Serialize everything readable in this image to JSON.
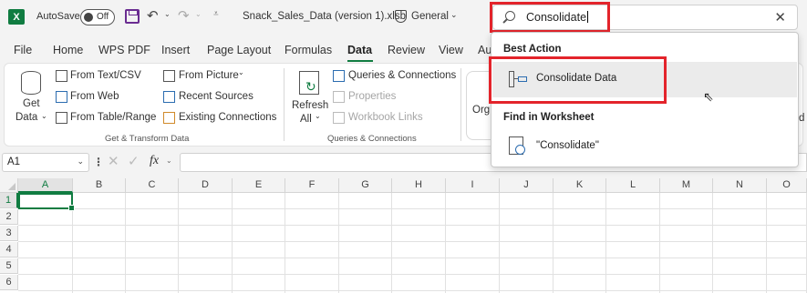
{
  "titlebar": {
    "app_logo": "X",
    "autosave_label": "AutoSave",
    "autosave_state": "Off",
    "document_title": "Snack_Sales_Data (version 1).xlsb",
    "sensitivity_label": "General",
    "icons": [
      "excel-logo-icon",
      "save-icon",
      "undo-icon",
      "redo-icon",
      "customize-qat-icon",
      "shield-icon"
    ]
  },
  "search": {
    "query": "Consolidate",
    "close_glyph": "✕"
  },
  "search_dropdown": {
    "best_action_heading": "Best Action",
    "best_action_item": "Consolidate Data",
    "find_heading": "Find in Worksheet",
    "find_item": "\"Consolidate\""
  },
  "tabs": [
    "File",
    "Home",
    "WPS PDF",
    "Insert",
    "Page Layout",
    "Formulas",
    "Data",
    "Review",
    "View",
    "Au"
  ],
  "active_tab": "Data",
  "ribbon": {
    "get_data_label_1": "Get",
    "get_data_label_2": "Data",
    "from_text_csv": "From Text/CSV",
    "from_web": "From Web",
    "from_table_range": "From Table/Range",
    "from_picture": "From Picture",
    "recent_sources": "Recent Sources",
    "existing_connections": "Existing Connections",
    "group_get_transform": "Get & Transform Data",
    "refresh_label_1": "Refresh",
    "refresh_label_2": "All",
    "queries_connections": "Queries & Connections",
    "properties": "Properties",
    "workbook_links": "Workbook Links",
    "group_queries": "Queries & Connections",
    "peek_left": "Org",
    "peek_right": "d"
  },
  "formula_bar": {
    "name_box": "A1",
    "fx": "fx",
    "formula": ""
  },
  "grid": {
    "columns": [
      "A",
      "B",
      "C",
      "D",
      "E",
      "F",
      "G",
      "H",
      "I",
      "J",
      "K",
      "L",
      "M",
      "N",
      "O"
    ],
    "rows": [
      "1",
      "2",
      "3",
      "4",
      "5",
      "6"
    ],
    "selected_cell": "A1"
  },
  "colors": {
    "accent_green": "#107c41",
    "highlight_red": "#e3242b",
    "hover_gray": "#ebebeb"
  }
}
